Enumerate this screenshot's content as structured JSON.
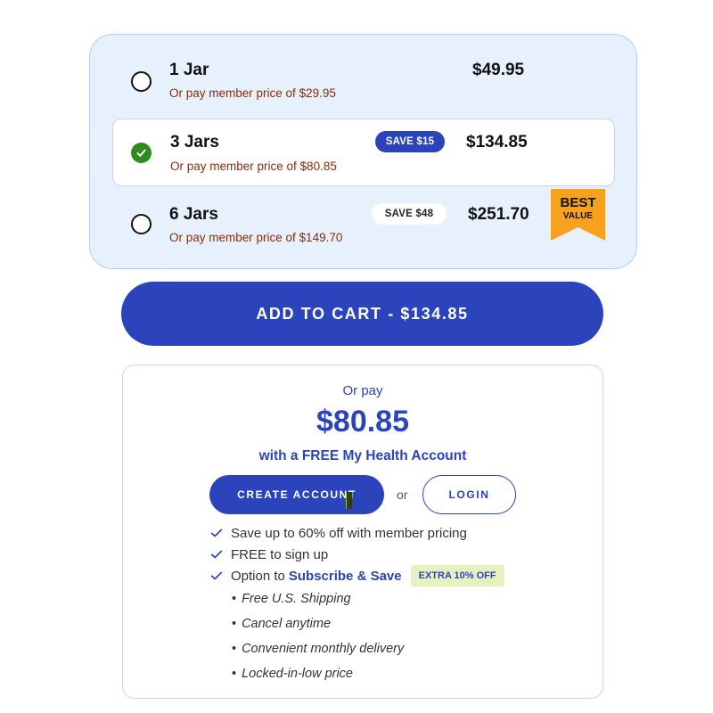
{
  "options": [
    {
      "title": "1 Jar",
      "member_text": "Or pay member price of $29.95",
      "price": "$49.95",
      "selected": false
    },
    {
      "title": "3 Jars",
      "member_text": "Or pay member price of $80.85",
      "price": "$134.85",
      "save": "SAVE $15",
      "selected": true
    },
    {
      "title": "6 Jars",
      "member_text": "Or pay member price of $149.70",
      "price": "$251.70",
      "save": "SAVE $48",
      "selected": false
    }
  ],
  "best_value": {
    "line1": "BEST",
    "line2": "VALUE",
    "color": "#f6a21e"
  },
  "add_to_cart": {
    "label": "ADD TO CART - $134.85"
  },
  "member": {
    "or_pay": "Or pay",
    "price": "$80.85",
    "tagline": "with a FREE My Health Account",
    "create_label": "CREATE ACCOUNT",
    "or": "or",
    "login_label": "LOGIN",
    "benefits": [
      {
        "text": "Save up to 60% off with member pricing"
      },
      {
        "text": "FREE to sign up"
      },
      {
        "text": "Option to",
        "link": "Subscribe & Save",
        "badge": "EXTRA 10% OFF"
      }
    ],
    "sub_items": [
      "Free U.S. Shipping",
      "Cancel anytime",
      "Convenient monthly delivery",
      "Locked-in-low price"
    ]
  },
  "colors": {
    "primary": "#2b44bb",
    "panel": "#e6f1fd",
    "member_text": "#8a2b0c",
    "check_green": "#2e8b1e",
    "badge_green": "#e5f2bd"
  }
}
